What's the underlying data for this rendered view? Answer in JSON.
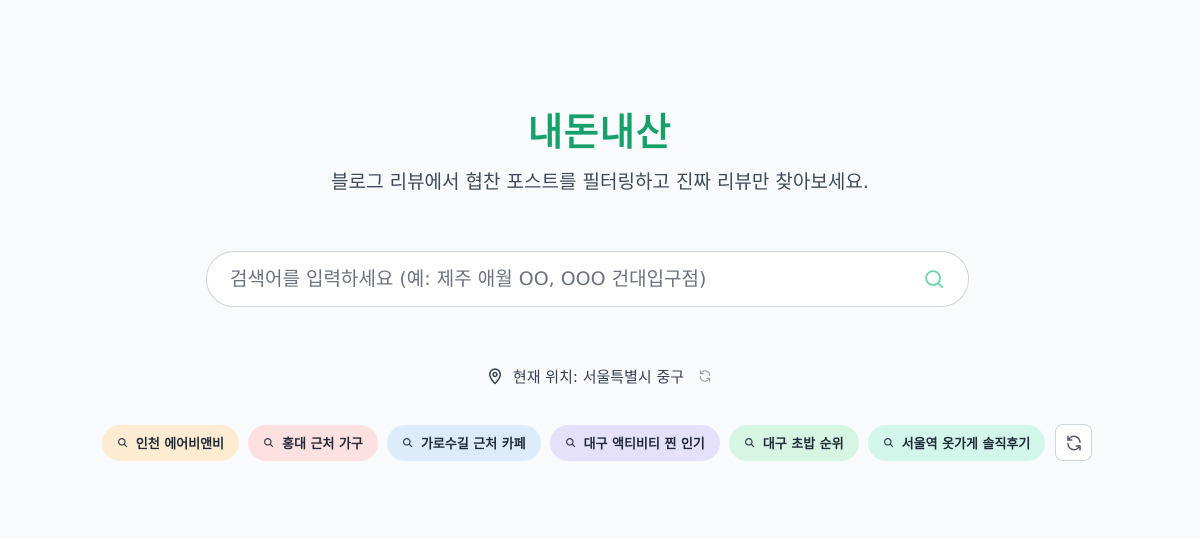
{
  "header": {
    "title": "내돈내산",
    "subtitle": "블로그 리뷰에서 협찬 포스트를 필터링하고 진짜 리뷰만 찾아보세요."
  },
  "search": {
    "placeholder": "검색어를 입력하세요 (예: 제주 애월 OO, OOO 건대입구점)",
    "value": "",
    "icon": "search-icon"
  },
  "location": {
    "label": "현재 위치: 서울특별시 중구",
    "icon": "map-pin-icon",
    "refresh_icon": "refresh-icon"
  },
  "suggestions": [
    {
      "label": "인천 에어비앤비",
      "color": "#fdecd2"
    },
    {
      "label": "홍대 근처 가구",
      "color": "#fde0e0"
    },
    {
      "label": "가로수길 근처 카페",
      "color": "#dcecfb"
    },
    {
      "label": "대구 액티비티 찐 인기",
      "color": "#e6e1fb"
    },
    {
      "label": "대구 초밥 순위",
      "color": "#d6f5e3"
    },
    {
      "label": "서울역 옷가게 솔직후기",
      "color": "#d2f6ea"
    }
  ],
  "colors": {
    "accent": "#16a06a",
    "background": "#f8fafc",
    "search_icon": "#6fd3a8"
  }
}
